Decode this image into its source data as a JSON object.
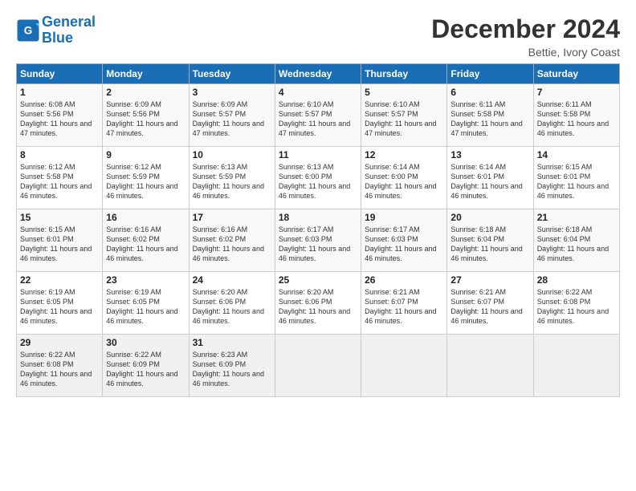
{
  "logo": {
    "line1": "General",
    "line2": "Blue"
  },
  "title": "December 2024",
  "location": "Bettie, Ivory Coast",
  "days_header": [
    "Sunday",
    "Monday",
    "Tuesday",
    "Wednesday",
    "Thursday",
    "Friday",
    "Saturday"
  ],
  "weeks": [
    [
      {
        "day": "1",
        "rise": "Sunrise: 6:08 AM",
        "set": "Sunset: 5:56 PM",
        "daylight": "Daylight: 11 hours and 47 minutes."
      },
      {
        "day": "2",
        "rise": "Sunrise: 6:09 AM",
        "set": "Sunset: 5:56 PM",
        "daylight": "Daylight: 11 hours and 47 minutes."
      },
      {
        "day": "3",
        "rise": "Sunrise: 6:09 AM",
        "set": "Sunset: 5:57 PM",
        "daylight": "Daylight: 11 hours and 47 minutes."
      },
      {
        "day": "4",
        "rise": "Sunrise: 6:10 AM",
        "set": "Sunset: 5:57 PM",
        "daylight": "Daylight: 11 hours and 47 minutes."
      },
      {
        "day": "5",
        "rise": "Sunrise: 6:10 AM",
        "set": "Sunset: 5:57 PM",
        "daylight": "Daylight: 11 hours and 47 minutes."
      },
      {
        "day": "6",
        "rise": "Sunrise: 6:11 AM",
        "set": "Sunset: 5:58 PM",
        "daylight": "Daylight: 11 hours and 47 minutes."
      },
      {
        "day": "7",
        "rise": "Sunrise: 6:11 AM",
        "set": "Sunset: 5:58 PM",
        "daylight": "Daylight: 11 hours and 46 minutes."
      }
    ],
    [
      {
        "day": "8",
        "rise": "Sunrise: 6:12 AM",
        "set": "Sunset: 5:58 PM",
        "daylight": "Daylight: 11 hours and 46 minutes."
      },
      {
        "day": "9",
        "rise": "Sunrise: 6:12 AM",
        "set": "Sunset: 5:59 PM",
        "daylight": "Daylight: 11 hours and 46 minutes."
      },
      {
        "day": "10",
        "rise": "Sunrise: 6:13 AM",
        "set": "Sunset: 5:59 PM",
        "daylight": "Daylight: 11 hours and 46 minutes."
      },
      {
        "day": "11",
        "rise": "Sunrise: 6:13 AM",
        "set": "Sunset: 6:00 PM",
        "daylight": "Daylight: 11 hours and 46 minutes."
      },
      {
        "day": "12",
        "rise": "Sunrise: 6:14 AM",
        "set": "Sunset: 6:00 PM",
        "daylight": "Daylight: 11 hours and 46 minutes."
      },
      {
        "day": "13",
        "rise": "Sunrise: 6:14 AM",
        "set": "Sunset: 6:01 PM",
        "daylight": "Daylight: 11 hours and 46 minutes."
      },
      {
        "day": "14",
        "rise": "Sunrise: 6:15 AM",
        "set": "Sunset: 6:01 PM",
        "daylight": "Daylight: 11 hours and 46 minutes."
      }
    ],
    [
      {
        "day": "15",
        "rise": "Sunrise: 6:15 AM",
        "set": "Sunset: 6:01 PM",
        "daylight": "Daylight: 11 hours and 46 minutes."
      },
      {
        "day": "16",
        "rise": "Sunrise: 6:16 AM",
        "set": "Sunset: 6:02 PM",
        "daylight": "Daylight: 11 hours and 46 minutes."
      },
      {
        "day": "17",
        "rise": "Sunrise: 6:16 AM",
        "set": "Sunset: 6:02 PM",
        "daylight": "Daylight: 11 hours and 46 minutes."
      },
      {
        "day": "18",
        "rise": "Sunrise: 6:17 AM",
        "set": "Sunset: 6:03 PM",
        "daylight": "Daylight: 11 hours and 46 minutes."
      },
      {
        "day": "19",
        "rise": "Sunrise: 6:17 AM",
        "set": "Sunset: 6:03 PM",
        "daylight": "Daylight: 11 hours and 46 minutes."
      },
      {
        "day": "20",
        "rise": "Sunrise: 6:18 AM",
        "set": "Sunset: 6:04 PM",
        "daylight": "Daylight: 11 hours and 46 minutes."
      },
      {
        "day": "21",
        "rise": "Sunrise: 6:18 AM",
        "set": "Sunset: 6:04 PM",
        "daylight": "Daylight: 11 hours and 46 minutes."
      }
    ],
    [
      {
        "day": "22",
        "rise": "Sunrise: 6:19 AM",
        "set": "Sunset: 6:05 PM",
        "daylight": "Daylight: 11 hours and 46 minutes."
      },
      {
        "day": "23",
        "rise": "Sunrise: 6:19 AM",
        "set": "Sunset: 6:05 PM",
        "daylight": "Daylight: 11 hours and 46 minutes."
      },
      {
        "day": "24",
        "rise": "Sunrise: 6:20 AM",
        "set": "Sunset: 6:06 PM",
        "daylight": "Daylight: 11 hours and 46 minutes."
      },
      {
        "day": "25",
        "rise": "Sunrise: 6:20 AM",
        "set": "Sunset: 6:06 PM",
        "daylight": "Daylight: 11 hours and 46 minutes."
      },
      {
        "day": "26",
        "rise": "Sunrise: 6:21 AM",
        "set": "Sunset: 6:07 PM",
        "daylight": "Daylight: 11 hours and 46 minutes."
      },
      {
        "day": "27",
        "rise": "Sunrise: 6:21 AM",
        "set": "Sunset: 6:07 PM",
        "daylight": "Daylight: 11 hours and 46 minutes."
      },
      {
        "day": "28",
        "rise": "Sunrise: 6:22 AM",
        "set": "Sunset: 6:08 PM",
        "daylight": "Daylight: 11 hours and 46 minutes."
      }
    ],
    [
      {
        "day": "29",
        "rise": "Sunrise: 6:22 AM",
        "set": "Sunset: 6:08 PM",
        "daylight": "Daylight: 11 hours and 46 minutes."
      },
      {
        "day": "30",
        "rise": "Sunrise: 6:22 AM",
        "set": "Sunset: 6:09 PM",
        "daylight": "Daylight: 11 hours and 46 minutes."
      },
      {
        "day": "31",
        "rise": "Sunrise: 6:23 AM",
        "set": "Sunset: 6:09 PM",
        "daylight": "Daylight: 11 hours and 46 minutes."
      },
      null,
      null,
      null,
      null
    ]
  ]
}
